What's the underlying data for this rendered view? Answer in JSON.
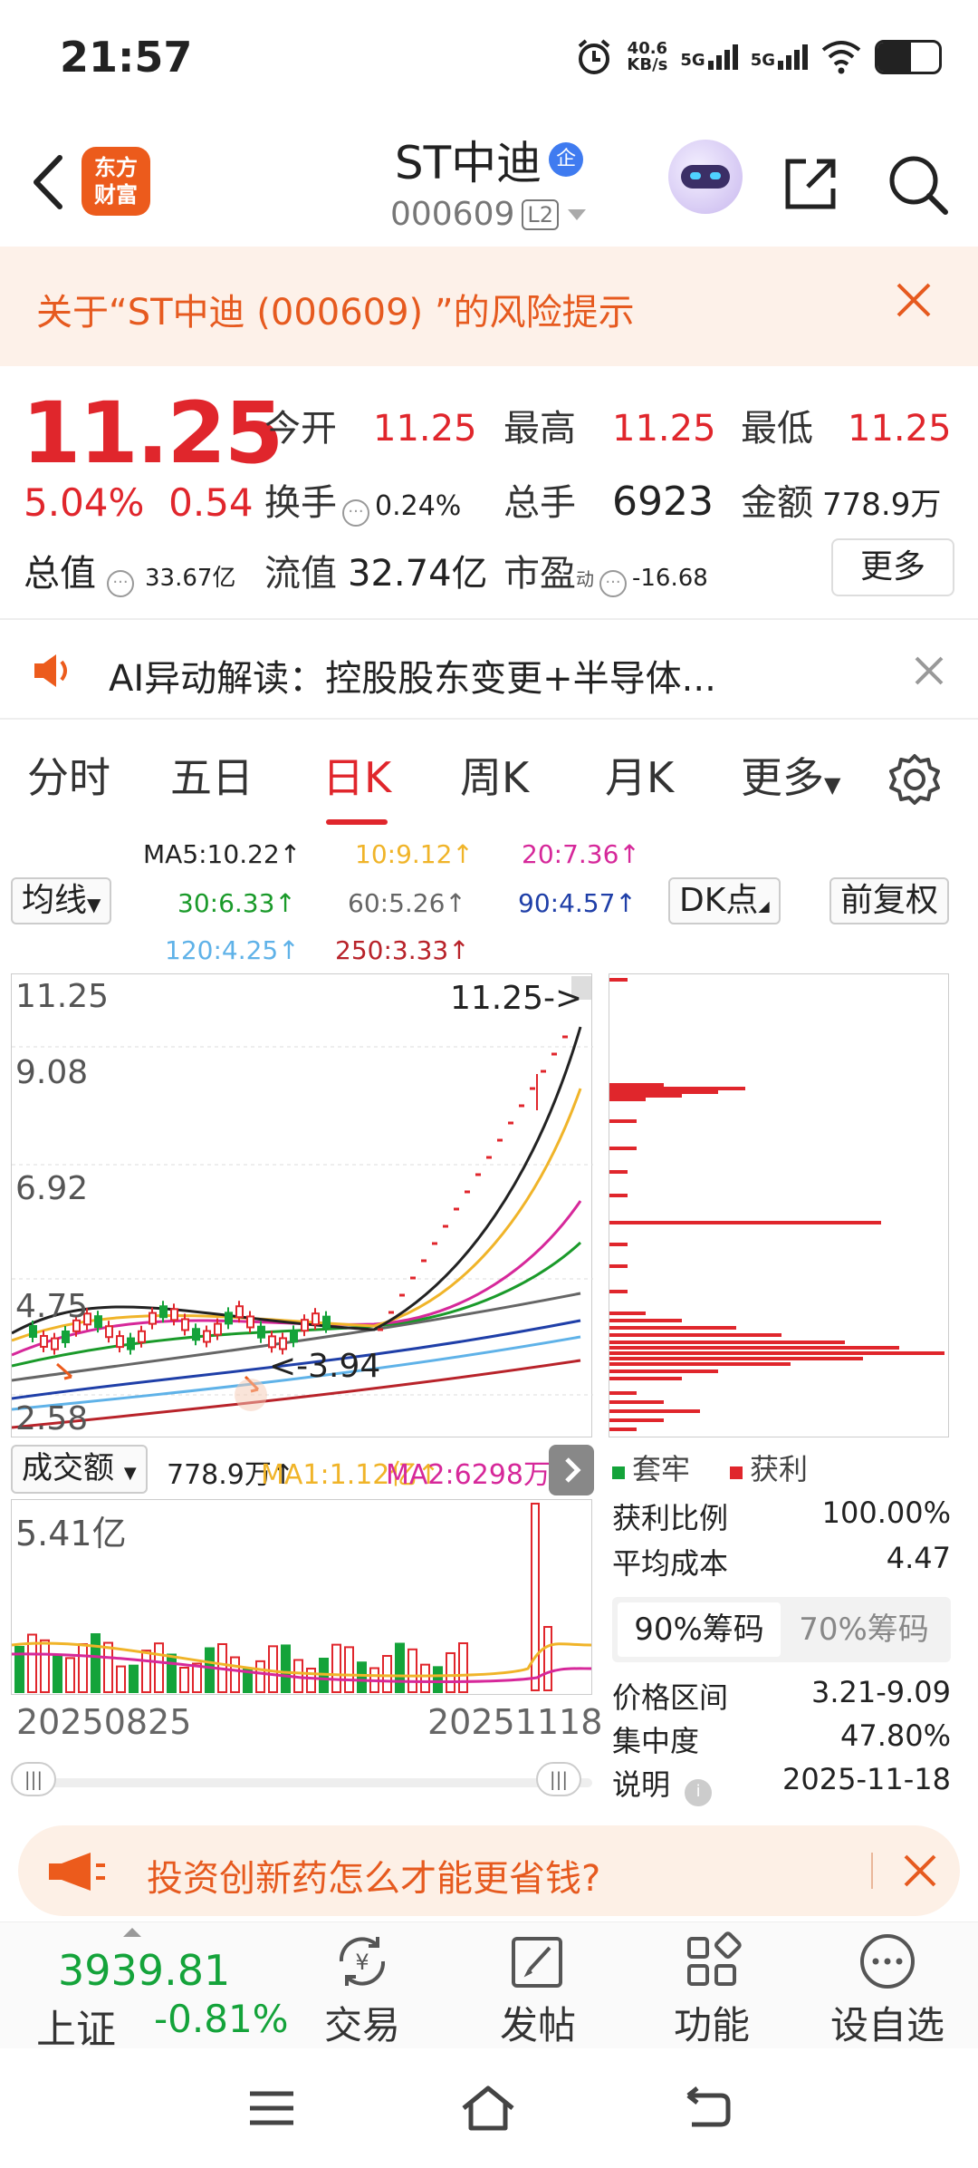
{
  "status": {
    "time": "21:57",
    "net_speed_top": "40.6",
    "net_speed_unit": "KB/s",
    "sig1": "5G",
    "sig2": "5G"
  },
  "header": {
    "logo_line1": "东方",
    "logo_line2": "财富",
    "name": "ST中迪",
    "badge": "企",
    "code": "000609",
    "level": "L2"
  },
  "risk": {
    "text": "关于“ST中迪 (000609) ”的风险提示"
  },
  "quote": {
    "price": "11.25",
    "pct": "5.04%",
    "change": "0.54",
    "open_label": "今开",
    "open": "11.25",
    "high_label": "最高",
    "high": "11.25",
    "low_label": "最低",
    "low": "11.25",
    "turnover_label": "换手",
    "turnover": "0.24%",
    "volume_label": "总手",
    "volume": "6923",
    "amount_label": "金额",
    "amount": "778.9万",
    "mktcap_label": "总值",
    "mktcap": "33.67亿",
    "float_label": "流值",
    "float_val": "32.74亿",
    "pe_label": "市盈",
    "pe_sup": "动",
    "pe": "-16.68",
    "more": "更多"
  },
  "ai": {
    "text": "AI异动解读：控股股东变更+半导体..."
  },
  "tabs": [
    "分时",
    "五日",
    "日K",
    "周K",
    "月K",
    "更多"
  ],
  "ma": {
    "ma5": "MA5:10.22↑",
    "ma10": "10:9.12↑",
    "ma20": "20:7.36↑",
    "ma30": "30:6.33↑",
    "ma60": "60:5.26↑",
    "ma90": "90:4.57↑",
    "ma120": "120:4.25↑",
    "ma250": "250:3.33↑",
    "btn_avg": "均线",
    "btn_dk": "DK点",
    "btn_adj": "前复权",
    "colors": {
      "ma5": "#222222",
      "ma10": "#f0b429",
      "ma20": "#d6289a",
      "ma30": "#1a9a2a",
      "ma60": "#666666",
      "ma90": "#1f3fa8",
      "ma120": "#5fb2e8",
      "ma250": "#b8232a"
    }
  },
  "kchart": {
    "y_labels": [
      "11.25",
      "9.08",
      "6.92",
      "4.75",
      "2.58"
    ],
    "high_marker": "11.25->",
    "low_marker": "<-3.94"
  },
  "volume": {
    "selector": "成交额",
    "val": "778.9万↑",
    "ma1": "MA1:1.12亿↑",
    "ma2": "MA2:6298万↓",
    "max_label": "5.41亿",
    "date_start": "20250825",
    "date_end": "20251118"
  },
  "chip": {
    "legend_trapped": "套牢",
    "legend_profit": "获利",
    "profit_ratio_label": "获利比例",
    "profit_ratio": "100.00%",
    "avg_cost_label": "平均成本",
    "avg_cost": "4.47",
    "tab_90": "90%筹码",
    "tab_70": "70%筹码",
    "range_label": "价格区间",
    "range": "3.21-9.09",
    "conc_label": "集中度",
    "conc": "47.80%",
    "note_label": "说明",
    "note_date": "2025-11-18"
  },
  "ad": {
    "text": "投资创新药怎么才能更省钱?"
  },
  "toolbar": {
    "index_val": "3939.81",
    "index_name": "上证",
    "index_chg": "-0.81%",
    "trade": "交易",
    "post": "发帖",
    "func": "功能",
    "watch": "设自选"
  }
}
